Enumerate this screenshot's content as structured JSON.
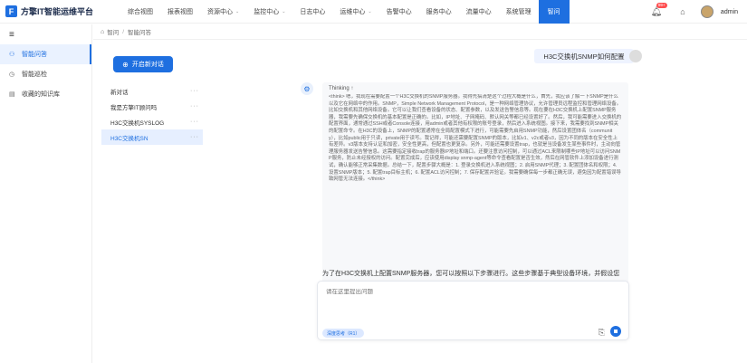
{
  "app": {
    "logo_letter": "F",
    "title": "方擎IT智能运维平台"
  },
  "nav": [
    {
      "label": "综合视图",
      "dropdown": false,
      "active": false
    },
    {
      "label": "报表视图",
      "dropdown": false,
      "active": false
    },
    {
      "label": "资源中心",
      "dropdown": true,
      "active": false
    },
    {
      "label": "监控中心",
      "dropdown": true,
      "active": false
    },
    {
      "label": "日志中心",
      "dropdown": false,
      "active": false
    },
    {
      "label": "运维中心",
      "dropdown": true,
      "active": false
    },
    {
      "label": "告警中心",
      "dropdown": false,
      "active": false
    },
    {
      "label": "服务中心",
      "dropdown": false,
      "active": false
    },
    {
      "label": "流量中心",
      "dropdown": false,
      "active": false
    },
    {
      "label": "系统管理",
      "dropdown": false,
      "active": false
    },
    {
      "label": "智问",
      "dropdown": false,
      "active": true
    }
  ],
  "header_right": {
    "notification_count": "99+",
    "username": "admin"
  },
  "sidebar": {
    "items": [
      {
        "label": "智能问答",
        "icon": "robot-icon",
        "glyph": "⚇",
        "active": true
      },
      {
        "label": "智能巡检",
        "icon": "inspect-icon",
        "glyph": "◷",
        "active": false
      },
      {
        "label": "收藏的知识库",
        "icon": "book-icon",
        "glyph": "▤",
        "active": false
      }
    ]
  },
  "breadcrumb": {
    "root": "智问",
    "current": "智能问答"
  },
  "conversations": {
    "new_chat_label": "开启新对话",
    "items": [
      {
        "label": "新对话",
        "active": false
      },
      {
        "label": "我是方擎IT顾问吗",
        "active": false
      },
      {
        "label": "H3C交换机SYSLOG",
        "active": false
      },
      {
        "label": "H3C交换机SN",
        "active": true
      }
    ]
  },
  "chat": {
    "user_message": "H3C交换机SNMP如何配置",
    "thinking_label": "Thinking ↑",
    "thinking_text": "<think> 嗯，我现在需要配置一个H3C交换机的SNMP服务器。我得先搞清楚这个过程大概是什么，首先，我应该了解一下SNMP是什么以及它在网络中的作用。SNMP，Simple Network Management Protocol，是一种网络管理协议，允许管理员远程监控和管理网络设备。比如交换机和其他网络设备。它可以让我们查看设备的状态、配置参数，以及发送告警信息等。现在要在H3C交换机上配置SNMP服务器，我需要先确保交换机的基本配置是正确的。比如，IP地址、子网掩码、默认网关等都已经设置好了。然后，我可能需要进入交换机的配置界面，通常通过SSH或者Console连接，用admin或者其他有权限的账号登录，然后进入系统视图。接下来，我需要找到SNMP相关的配置命令。在H3C的设备上，SNMP的配置通常在全局配置模式下进行，可能需要先启用SNMP功能，然后设置团体名（community），比如public用于只读，private用于读写。我记得，可能还需要配置SNMP的版本，比如v1、v2c或者v3，因为不同的版本在安全性上有差异。v3版本支持认证和加密，安全性更高，但配置也更复杂。另外，可能还需要设置trap，也就是当设备发生某些事件时，主动向管理服务器发送告警信息。这需要指定接收trap的服务器IP地址和端口。还要注意访问控制，可以通过ACL来限制哪些IP地址可以访问SNMP服务，防止未经授权的访问。配置完成后，应该使用display snmp-agent等命令查看配置是否生效，然后在网管软件上添加设备进行测试，确认能够正常采集数据。总结一下，配置步骤大概是：1. 登录交换机进入系统视图；2. 启用SNMP代理；3. 配置团体名和权限；4. 设置SNMP版本；5. 配置trap目标主机；6. 配置ACL访问控制；7. 保存配置并验证。我需要确保每一步都正确无误，避免因为配置错误导致网管无法连接。</think>",
    "answer_text": "为了在H3C交换机上配置SNMP服务器，您可以按照以下步骤进行。这些步骤基于典型设备环境，并假设您",
    "input_placeholder": "请在这里提出问题",
    "deep_think_label": "深度思考（R1）"
  },
  "colors": {
    "accent": "#1e6fe0",
    "badge": "#ff4d4f"
  }
}
